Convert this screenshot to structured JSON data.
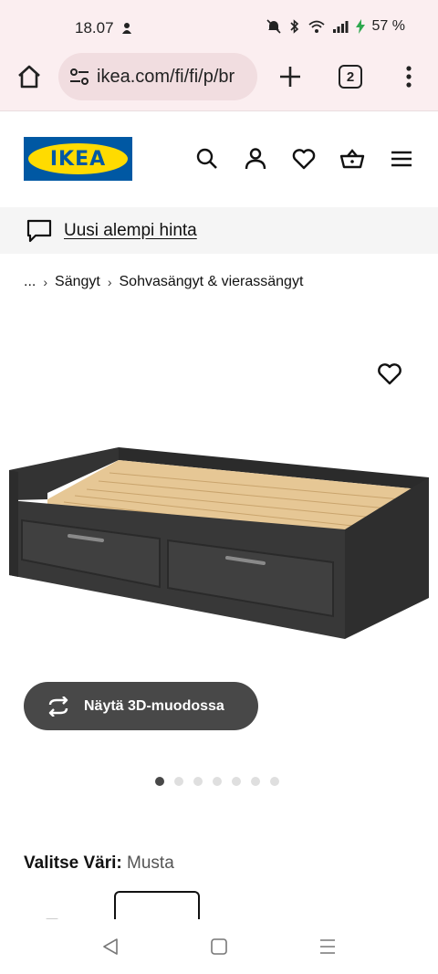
{
  "status_bar": {
    "time": "18.07",
    "battery": "57 %"
  },
  "browser": {
    "url": "ikea.com/fi/fi/p/br",
    "tab_count": "2"
  },
  "header": {
    "logo_text": "IKEA",
    "icons": [
      "search-icon",
      "account-icon",
      "favourites-icon",
      "cart-icon",
      "menu-icon"
    ]
  },
  "promo": {
    "label": "Uusi alempi hinta"
  },
  "breadcrumb": {
    "ellipsis": "...",
    "items": [
      "Sängyt",
      "Sohvasängyt & vierassängyt"
    ]
  },
  "product": {
    "view_3d_label": "Näytä 3D-muodossa",
    "carousel": {
      "count": 7,
      "active": 0
    },
    "color_heading": "Valitse Väri:",
    "color_value": "Musta"
  },
  "colors": {
    "brand_blue": "#0058a3",
    "brand_yellow": "#ffdb00",
    "button_dark": "#484848"
  }
}
